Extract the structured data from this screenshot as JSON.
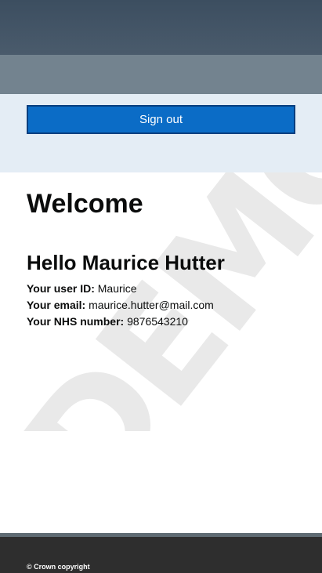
{
  "header": {
    "signout_label": "Sign out"
  },
  "watermark": {
    "text": "DEMO"
  },
  "main": {
    "title": "Welcome",
    "greeting": "Hello Maurice Hutter",
    "details": [
      {
        "label": "Your user ID:",
        "value": "Maurice"
      },
      {
        "label": "Your email:",
        "value": "maurice.hutter@mail.com"
      },
      {
        "label": "Your NHS number:",
        "value": "9876543210"
      }
    ]
  },
  "footer": {
    "copyright": "© Crown copyright"
  },
  "colors": {
    "header": "#3c4e60",
    "subheader": "#73838f",
    "panel": "#e4edf5",
    "button": "#0b6cc6",
    "footer": "#2e2e2e"
  }
}
